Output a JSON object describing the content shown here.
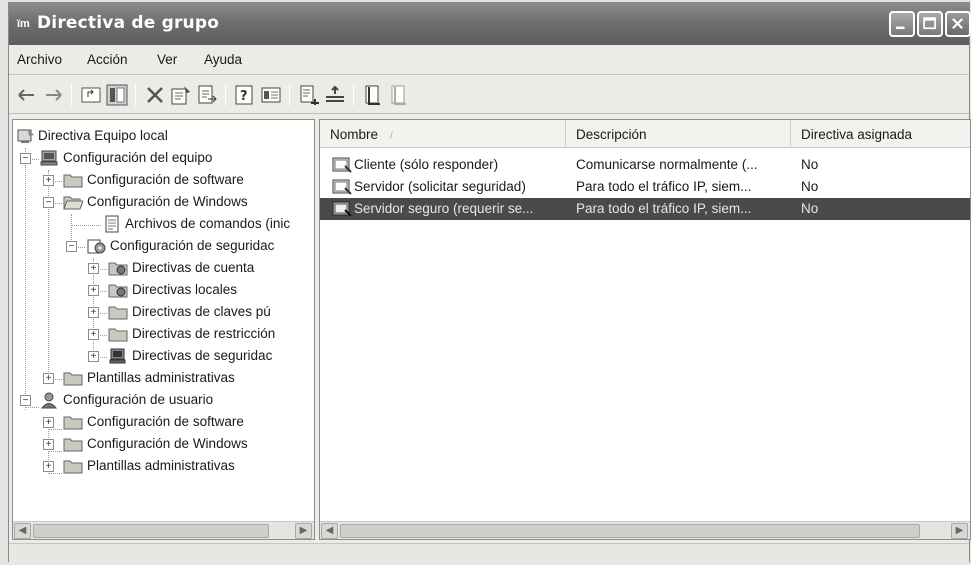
{
  "window": {
    "icon_text": "ïm",
    "title": "Directiva de grupo"
  },
  "menu": [
    "Archivo",
    "Acción",
    "Ver",
    "Ayuda"
  ],
  "toolbar_icons": [
    "back-arrow-icon",
    "forward-arrow-icon",
    "up-folder-icon",
    "show-hide-tree-icon",
    "delete-icon",
    "properties-icon",
    "export-list-icon",
    "help-icon",
    "view-icon",
    "assign-policy-icon",
    "unassign-policy-icon",
    "policy-icon-1",
    "policy-icon-2"
  ],
  "tree": {
    "root": "Directiva Equipo local",
    "computer_config": "Configuración del equipo",
    "c_software": "Configuración de software",
    "c_windows": "Configuración de Windows",
    "scripts": "Archivos de comandos (inic",
    "security": "Configuración de seguridac",
    "account": "Directivas de cuenta",
    "local": "Directivas locales",
    "public_key": "Directivas de claves pú",
    "restriction": "Directivas de restricción",
    "ipsec": "Directivas de seguridac",
    "c_admin": "Plantillas administrativas",
    "user_config": "Configuración de usuario",
    "u_software": "Configuración de software",
    "u_windows": "Configuración de Windows",
    "u_admin": "Plantillas administrativas"
  },
  "list": {
    "columns": [
      "Nombre",
      "Descripción",
      "Directiva asignada"
    ],
    "sort_indicator": "/",
    "rows": [
      {
        "name": "Cliente (sólo responder)",
        "description": "Comunicarse normalmente (...",
        "assigned": "No",
        "selected": false
      },
      {
        "name": "Servidor (solicitar seguridad)",
        "description": "Para todo el tráfico IP, siem...",
        "assigned": "No",
        "selected": false
      },
      {
        "name": "Servidor seguro (requerir se...",
        "description": "Para todo el tráfico IP, siem...",
        "assigned": "No",
        "selected": true
      }
    ]
  },
  "colors": {
    "titlebar": "#6e6e6e",
    "selection": "#4a4a4a",
    "folder": "#c9c9bf"
  }
}
